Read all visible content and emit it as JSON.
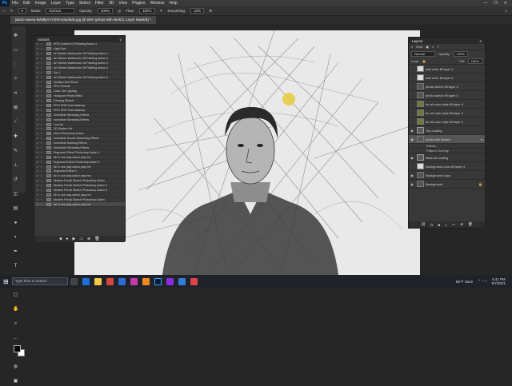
{
  "menubar": {
    "app_icon": "Ps",
    "items": [
      "File",
      "Edit",
      "Image",
      "Layer",
      "Type",
      "Select",
      "Filter",
      "3D",
      "View",
      "Plugins",
      "Window",
      "Help"
    ],
    "window_buttons": [
      "—",
      "❐",
      "✕"
    ]
  },
  "options": {
    "mode_label": "Mode:",
    "mode_value": "Normal",
    "opacity_label": "Opacity:",
    "opacity_value": "100%",
    "flow_label": "Flow:",
    "flow_value": "100%",
    "smoothing_label": "Smoothing:",
    "smoothing_value": "10%"
  },
  "document": {
    "tab_title": "jakob-owens-bW9lpYxYzK9-unsplash.jpg @ 50% (photo with sketch, Layer Mask/8) *"
  },
  "actions_panel": {
    "title": "Actions",
    "rows": [
      "PRO Colorful Oil Painting Action 2",
      "Light Sort",
      "Art Sketch Watercolor Oil Painting Action 1",
      "Art Sketch Watercolor Oil Painting Action 2",
      "Art Sketch Watercolor Oil Painting Action 3",
      "Art Sketch Watercolor Oil Painting Action 4",
      "Set 1",
      "Art Sketch Watercolor Oil Painting Action 5",
      "Quality Hand Draw",
      "PRO Portrait",
      "Color Gel Lighting",
      "Hologram Photo Effect",
      "Glowing Sketch",
      "PRO HDR Face Makeup",
      "PRO HDR Face Makeup",
      "Incredible Sketching Effects",
      "Incredible Sketching Effects",
      "Low Art",
      "3D Modern Art",
      "Neon Photoshop Action",
      "Incredible Smoke Sketching Effects",
      "Incredible Drawing Effects",
      "Incredible Sketching Effects",
      "Engraved Effect Photoshop Action 1",
      "All in one play action play me",
      "Engraved Effect Photoshop Action 2",
      "All in one play action play me",
      "Engraved Effect 3",
      "All in one play action play me",
      "Modern Pencil Sketch Photoshop Action",
      "Modern Pencil Sketch Photoshop Action 2",
      "Modern Pencil Sketch Photoshop Action 3",
      "All in one play action play me",
      "Modern Pencil Sketch Photoshop Action",
      "All in one play action play me"
    ]
  },
  "layers_panel": {
    "title": "Layers",
    "kind_label": "Kind",
    "blend_value": "Normal",
    "opacity_label": "Opacity:",
    "opacity_value": "100%",
    "lock_label": "Lock:",
    "fill_label": "Fill:",
    "fill_value": "100%",
    "rows": [
      "add color fill layer 4",
      "add color fill layer 4",
      "photo sketch fill layer 4",
      "photo sketch fill layer 4",
      "for all color style fill layer 4",
      "for all color style fill layer 4",
      "for all color style fill layer 4",
      "Top coating",
      "photo with sketch",
      "Effects",
      "Pattern Overlay",
      "Back all coating",
      "Background color fill layer 4",
      "Background copy",
      "Background"
    ]
  },
  "taskbar": {
    "search_placeholder": "Type here to search",
    "weather": "86°F Haze",
    "time": "4:41 PM",
    "date": "9/7/2021"
  },
  "colors": {
    "accent": "#31a8ff",
    "panel_bg": "#383838",
    "canvas_bg": "#e9e9e9",
    "highlight": "#e6cc3a"
  }
}
